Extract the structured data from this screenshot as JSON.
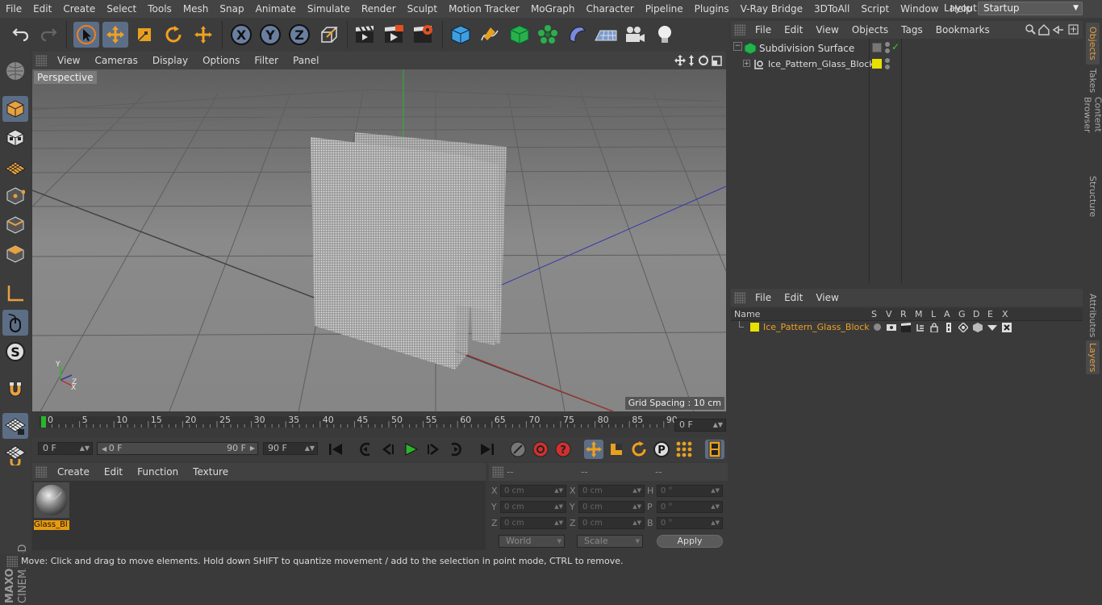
{
  "menubar": {
    "items": [
      "File",
      "Edit",
      "Create",
      "Select",
      "Tools",
      "Mesh",
      "Snap",
      "Animate",
      "Simulate",
      "Render",
      "Sculpt",
      "Motion Tracker",
      "MoGraph",
      "Character",
      "Pipeline",
      "Plugins",
      "V-Ray Bridge",
      "3DToAll",
      "Script",
      "Window",
      "Help"
    ],
    "layout_label": "Layout:",
    "layout_value": "Startup"
  },
  "viewport": {
    "menu": [
      "View",
      "Cameras",
      "Display",
      "Options",
      "Filter",
      "Panel"
    ],
    "label": "Perspective",
    "grid_spacing": "Grid Spacing : 10 cm",
    "axis_y": "Y",
    "axis_x": "X",
    "axis_z": "Z"
  },
  "timeline": {
    "ticks": [
      "0",
      "5",
      "10",
      "15",
      "20",
      "25",
      "30",
      "35",
      "40",
      "45",
      "50",
      "55",
      "60",
      "65",
      "70",
      "75",
      "80",
      "85",
      "90"
    ],
    "current_frame": "0 F"
  },
  "playbar": {
    "start_field": "0 F",
    "range_start": "0 F",
    "range_end": "90 F",
    "end_field": "90 F"
  },
  "material_manager": {
    "menu": [
      "Create",
      "Edit",
      "Function",
      "Texture"
    ],
    "material_name": "Glass_Bl"
  },
  "coordinates": {
    "headers": [
      "--",
      "--",
      "--"
    ],
    "rows": [
      {
        "l1": "X",
        "v1": "0 cm",
        "l2": "X",
        "v2": "0 cm",
        "l3": "H",
        "v3": "0 °"
      },
      {
        "l1": "Y",
        "v1": "0 cm",
        "l2": "Y",
        "v2": "0 cm",
        "l3": "P",
        "v3": "0 °"
      },
      {
        "l1": "Z",
        "v1": "0 cm",
        "l2": "Z",
        "v2": "0 cm",
        "l3": "B",
        "v3": "0 °"
      }
    ],
    "world": "World",
    "scale": "Scale",
    "apply": "Apply"
  },
  "statusbar": {
    "text": "Move: Click and drag to move elements. Hold down SHIFT to quantize movement / add to the selection in point mode, CTRL to remove."
  },
  "object_manager": {
    "menu": [
      "File",
      "Edit",
      "View",
      "Objects",
      "Tags",
      "Bookmarks"
    ],
    "objects": [
      "Subdivision Surface",
      "Ice_Pattern_Glass_Block"
    ]
  },
  "layer_manager": {
    "menu": [
      "File",
      "Edit",
      "View"
    ],
    "col_name": "Name",
    "cols": [
      "S",
      "V",
      "R",
      "M",
      "L",
      "A",
      "G",
      "D",
      "E",
      "X"
    ],
    "layer_name": "Ice_Pattern_Glass_Block"
  },
  "right_tabs": [
    "Objects",
    "Takes",
    "Content Browser",
    "Structure",
    "Attributes",
    "Layers"
  ],
  "colors": {
    "accent": "#5c6e86",
    "selected_text": "#f0a020",
    "layer_yellow": "#e8e000",
    "green_axis": "#2bb52b"
  }
}
